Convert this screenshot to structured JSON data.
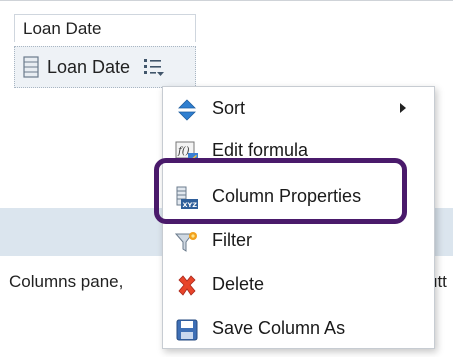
{
  "column": {
    "header_label": "Loan Date",
    "chip_label": "Loan Date"
  },
  "help": {
    "text_left": "Columns pane,",
    "text_tail": "utt"
  },
  "menu": {
    "items": [
      {
        "label": "Sort",
        "icon": "sort-icon",
        "has_submenu": true
      },
      {
        "label": "Edit formula",
        "icon": "formula-icon",
        "has_submenu": false
      },
      {
        "label": "Column Properties",
        "icon": "column-properties-icon",
        "has_submenu": false
      },
      {
        "label": "Filter",
        "icon": "filter-icon",
        "has_submenu": false
      },
      {
        "label": "Delete",
        "icon": "delete-icon",
        "has_submenu": false
      },
      {
        "label": "Save Column As",
        "icon": "save-icon",
        "has_submenu": false
      }
    ]
  },
  "colors": {
    "highlight_border": "#4a1a6b",
    "band": "#dbe5ee",
    "chip_bg": "#eef2f6"
  }
}
